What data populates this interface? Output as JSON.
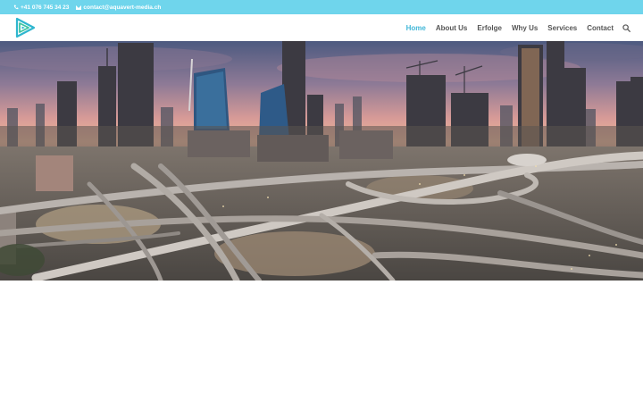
{
  "topbar": {
    "phone": "+41 076 745 34 23",
    "email": "contact@aquavert-media.ch"
  },
  "nav": {
    "items": [
      {
        "label": "Home",
        "active": true
      },
      {
        "label": "About Us",
        "active": false
      },
      {
        "label": "Erfolge",
        "active": false
      },
      {
        "label": "Why Us",
        "active": false
      },
      {
        "label": "Services",
        "active": false
      },
      {
        "label": "Contact",
        "active": false
      }
    ]
  },
  "colors": {
    "topbar": "#6fd5ec",
    "accent": "#42b7d8",
    "nav_text": "#555555"
  },
  "icons": {
    "phone": "phone-icon",
    "email": "mail-icon",
    "search": "search-icon",
    "logo": "logo-icon"
  }
}
